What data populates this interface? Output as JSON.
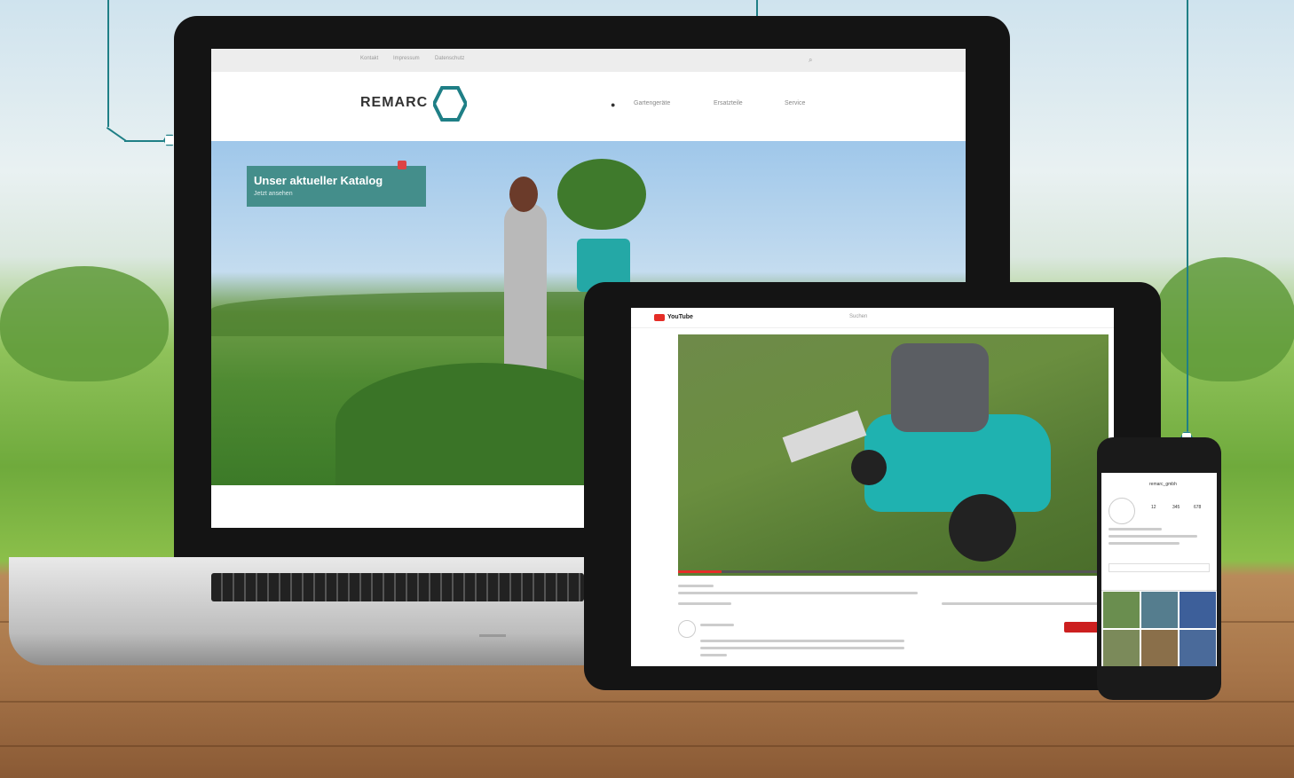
{
  "laptop": {
    "logo_text": "REMARC",
    "catalog_title": "Unser aktueller Katalog",
    "catalog_sub": "Jetzt ansehen",
    "util_links": [
      "Kontakt",
      "Impressum",
      "Datenschutz"
    ],
    "nav_links": [
      "Gartengeräte",
      "Ersatzteile",
      "Service"
    ]
  },
  "tablet": {
    "logo_text": "YouTube",
    "search_text": "Suchen",
    "progress": 0.1
  },
  "phone": {
    "username": "remarc_gmbh",
    "stats": [
      "12",
      "345",
      "678"
    ]
  },
  "colors": {
    "brand_teal": "#1f7f86",
    "catalog_teal": "#3e8a86",
    "youtube_red": "#e52d27"
  }
}
